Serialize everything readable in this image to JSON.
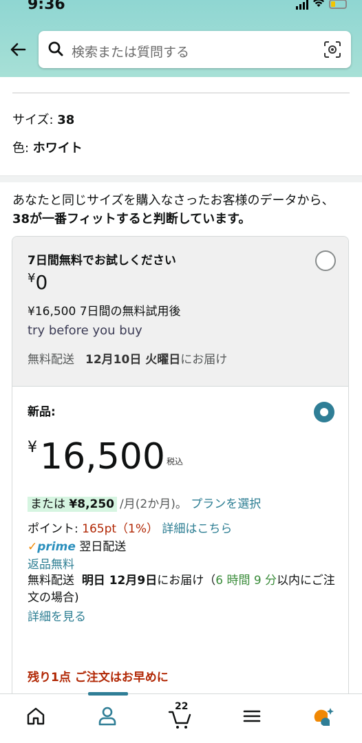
{
  "status_bar": {
    "time": "9:36"
  },
  "search": {
    "placeholder": "検索または質問する"
  },
  "product_attrs": {
    "size_label": "サイズ: ",
    "size_value": "38",
    "color_label": "色: ",
    "color_value": "ホワイト"
  },
  "fit_message": {
    "line_normal": "あなたと同じサイズを購入なさったお客様のデータから、",
    "line_bold": "38が一番フィットすると判断しています。"
  },
  "trial_option": {
    "title": "7日間無料でお試しください",
    "currency": "¥",
    "price": "0",
    "after_text": "¥16,500 7日間の無料試用後",
    "program": "try before you buy",
    "delivery_label": "無料配送",
    "delivery_date": "12月10日 火曜日",
    "delivery_suffix": "にお届け",
    "selected": false
  },
  "new_option": {
    "title": "新品:",
    "currency": "¥",
    "price": "16,500",
    "tax_label": "税込",
    "installment_prefix": "または ",
    "installment_amount": "¥8,250",
    "installment_period": "/月(2か月)。",
    "plan_link": "プランを選択",
    "points_label": "ポイント: ",
    "points_value": "165pt（1%）",
    "points_link": "詳細はこちら",
    "prime_check": "✓",
    "prime_word": "prime",
    "prime_delivery": "翌日配送",
    "returns": "返品無料",
    "ship_label": "無料配送",
    "ship_date": "明日 12月9日",
    "ship_mid": "にお届け（",
    "ship_window": "6 時間 9 分",
    "ship_tail": "以内にご注文の場合)",
    "details_link": "詳細を見る",
    "stock_warning": "残り1点 ご注文はお早めに",
    "selected": true
  },
  "bottom_nav": {
    "cart_count": "22",
    "active_tab": "account"
  }
}
